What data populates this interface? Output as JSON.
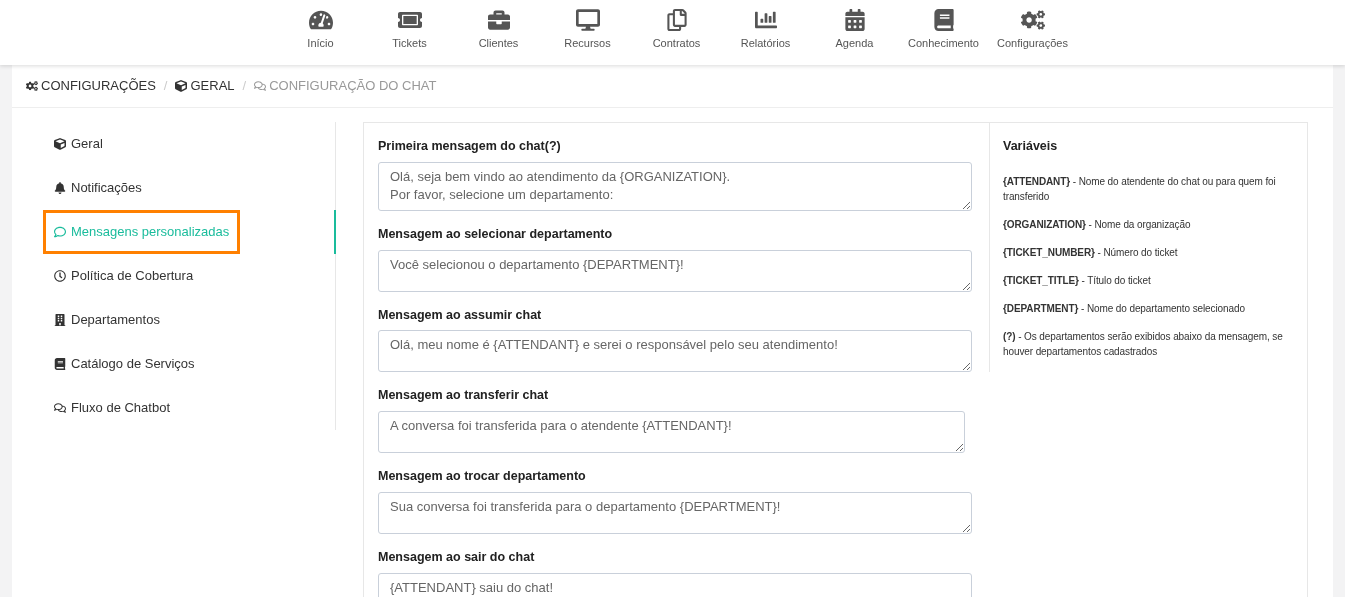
{
  "nav": [
    {
      "label": "Início"
    },
    {
      "label": "Tickets"
    },
    {
      "label": "Clientes"
    },
    {
      "label": "Recursos"
    },
    {
      "label": "Contratos"
    },
    {
      "label": "Relatórios"
    },
    {
      "label": "Agenda"
    },
    {
      "label": "Conhecimento"
    },
    {
      "label": "Configurações"
    }
  ],
  "breadcrumb_separator": "/",
  "breadcrumb": [
    {
      "label": "CONFIGURAÇÕES",
      "current": false
    },
    {
      "label": "GERAL",
      "current": false
    },
    {
      "label": "CONFIGURAÇÃO DO CHAT",
      "current": true
    }
  ],
  "sidebar": {
    "items": [
      {
        "label": "Geral",
        "selected": false
      },
      {
        "label": "Notificações",
        "selected": false
      },
      {
        "label": "Mensagens personalizadas",
        "selected": true
      },
      {
        "label": "Política de Cobertura",
        "selected": false
      },
      {
        "label": "Departamentos",
        "selected": false
      },
      {
        "label": "Catálogo de Serviços",
        "selected": false
      },
      {
        "label": "Fluxo de Chatbot",
        "selected": false
      }
    ]
  },
  "fields": [
    {
      "label": "Primeira mensagem do chat(?)",
      "value": "Olá, seja bem vindo ao atendimento da {ORGANIZATION}.\nPor favor, selecione um departamento:"
    },
    {
      "label": "Mensagem ao selecionar departamento",
      "value": "Você selecionou o departamento {DEPARTMENT}!"
    },
    {
      "label": "Mensagem ao assumir chat",
      "value": "Olá, meu nome é {ATTENDANT} e serei o responsável pelo seu atendimento!"
    },
    {
      "label": "Mensagem ao transferir chat",
      "value": "A conversa foi transferida para o atendente {ATTENDANT}!"
    },
    {
      "label": "Mensagem ao trocar departamento",
      "value": "Sua conversa foi transferida para o departamento {DEPARTMENT}!"
    },
    {
      "label": "Mensagem ao sair do chat",
      "value": "{ATTENDANT} saiu do chat!"
    }
  ],
  "variables": {
    "title": "Variáveis",
    "items": [
      "**{ATTENDANT}** - Nome do atendente do chat ou para quem foi transferido",
      "**{ORGANIZATION}** - Nome da organização",
      "**{TICKET_NUMBER}** - Número do ticket",
      "**{TICKET_TITLE}** - Título do ticket",
      "**{DEPARTMENT}** - Nome do departamento selecionado",
      "**(?)** - Os departamentos serão exibidos abaixo da mensagem, se houver departamentos cadastrados"
    ]
  }
}
